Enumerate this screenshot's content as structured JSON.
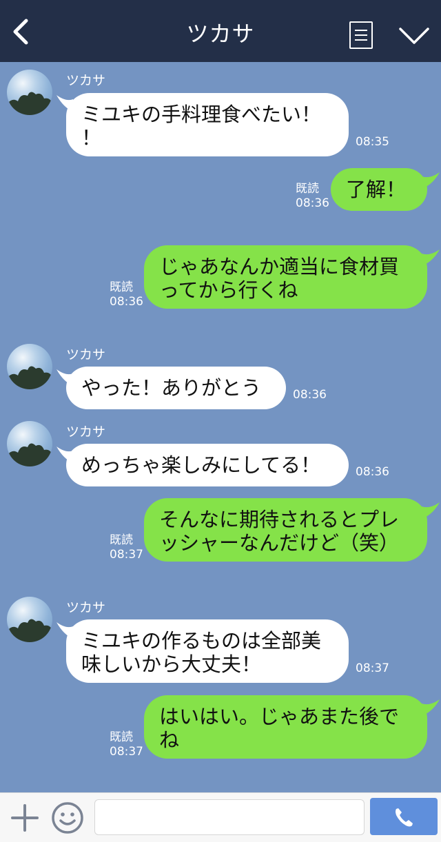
{
  "header": {
    "title": "ツカサ",
    "back_icon": "chevron-left-icon",
    "menu_icon": "list-icon",
    "collapse_icon": "chevron-down-icon"
  },
  "messages": [
    {
      "side": "left",
      "sender": "ツカサ",
      "text": "ミユキの手料理食べたい！\n！",
      "time": "08:35"
    },
    {
      "side": "right",
      "read": "既読",
      "text": "了解！",
      "time": "08:36"
    },
    {
      "side": "right",
      "read": "既読",
      "text": "じゃあなんか適当に食材買\nってから行くね",
      "time": "08:36"
    },
    {
      "side": "left",
      "sender": "ツカサ",
      "text": "やった！ありがとう",
      "time": "08:36"
    },
    {
      "side": "left",
      "sender": "ツカサ",
      "text": "めっちゃ楽しみにしてる！",
      "time": "08:36"
    },
    {
      "side": "right",
      "read": "既読",
      "text": "そんなに期待されるとプレ\nッシャーなんだけど（笑）",
      "time": "08:37"
    },
    {
      "side": "left",
      "sender": "ツカサ",
      "text": "ミユキの作るものは全部美\n味しいから大丈夫！",
      "time": "08:37"
    },
    {
      "side": "right",
      "read": "既読",
      "text": "はいはい。じゃあまた後で\nね",
      "time": "08:37"
    }
  ],
  "input_bar": {
    "placeholder": "",
    "plus_icon": "plus-icon",
    "emoji_icon": "smiley-icon",
    "send_icon": "phone-icon"
  },
  "colors": {
    "header_bg": "#232f48",
    "chat_bg": "#7494c2",
    "bubble_left": "#ffffff",
    "bubble_right": "#85e249",
    "send_button": "#5f8fdc"
  }
}
